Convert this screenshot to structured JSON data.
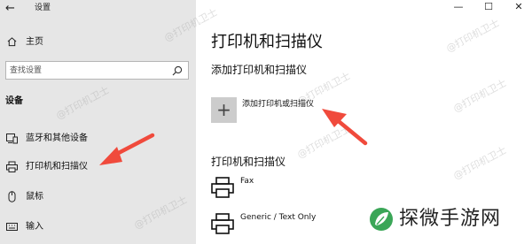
{
  "window": {
    "title": "设置",
    "controls": {
      "minimize": "—",
      "maximize": "☐",
      "close": "✕"
    }
  },
  "sidebar": {
    "back_label": "←",
    "home_label": "主页",
    "search": {
      "placeholder": "查找设置"
    },
    "section_label": "设备",
    "items": [
      {
        "label": "蓝牙和其他设备",
        "icon": "bluetooth-device-icon"
      },
      {
        "label": "打印机和扫描仪",
        "icon": "printer-icon"
      },
      {
        "label": "鼠标",
        "icon": "mouse-icon"
      },
      {
        "label": "输入",
        "icon": "keyboard-icon"
      }
    ]
  },
  "main": {
    "page_title": "打印机和扫描仪",
    "add_section": {
      "heading": "添加打印机和扫描仪",
      "add_tile_symbol": "+",
      "add_label": "添加打印机或扫描仪"
    },
    "printers_section": {
      "heading": "打印机和扫描仪",
      "printers": [
        {
          "name": "Fax"
        },
        {
          "name": "Generic / Text Only"
        }
      ]
    }
  },
  "overlay": {
    "watermark_text": "@打印机卫士",
    "arrow_color": "#f04a3c",
    "site_logo_text": "探微手游网",
    "site_logo_color": "#3aa657"
  }
}
